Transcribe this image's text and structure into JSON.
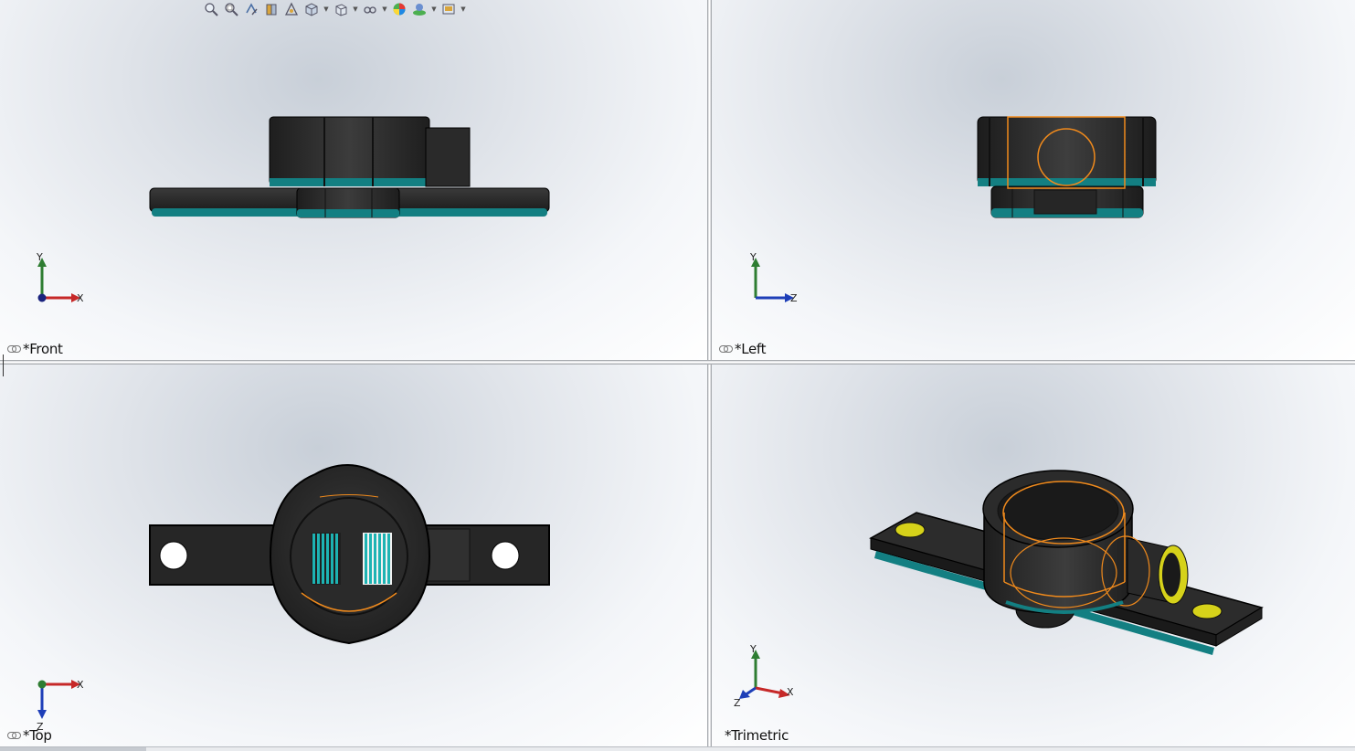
{
  "views": {
    "front": {
      "label": "*Front"
    },
    "left": {
      "label": "*Left"
    },
    "top": {
      "label": "*Top"
    },
    "trimetric": {
      "label": "*Trimetric"
    }
  },
  "axes": {
    "front": {
      "a": "Y",
      "b": "X"
    },
    "left": {
      "a": "Y",
      "b": "Z"
    },
    "top": {
      "a": "X",
      "b": "Z"
    },
    "trimetric": {
      "a": "Y",
      "b": "X",
      "c": "Z"
    }
  },
  "toolbar": {
    "buttons": [
      "zoom-to-fit-icon",
      "zoom-to-area-icon",
      "previous-view-icon",
      "section-view-icon",
      "dynamic-annotation-icon",
      "view-orientation-icon",
      "display-style-icon",
      "hide-show-items-icon",
      "edit-appearance-icon",
      "apply-scene-icon",
      "view-settings-icon"
    ]
  },
  "colors": {
    "body": "#2b2b2b",
    "teal_edge": "#138a8a",
    "highlight": "#f08a1c",
    "yellow_insert": "#d6d21a"
  }
}
